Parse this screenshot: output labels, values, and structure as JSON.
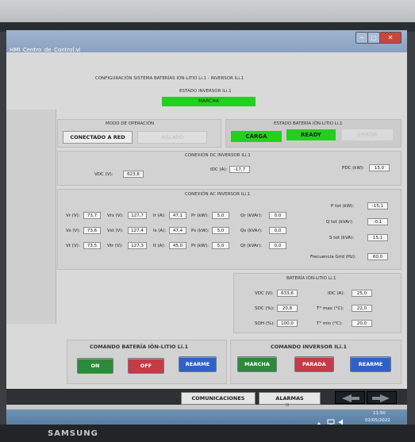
{
  "window": {
    "title": "HMI_Centro_de_Control.vi",
    "min_label": "−",
    "max_label": "□",
    "close_label": "✕"
  },
  "header": {
    "config_title": "CONFIGURACIÓN SISTEMA BATERÍAS IÓN-LITIO Li.1 - INVERSOR ILi.1",
    "inverter_state_title": "ESTADO INVERSOR ILi.1",
    "inverter_state_value": "MARCHA"
  },
  "operation_mode": {
    "title": "MODO DE OPERACIÓN",
    "connected": "CONECTADO A RED",
    "isolated": "AISLADO"
  },
  "battery_state": {
    "title": "ESTADO BATERÍA IÓN-LITIO Li.1",
    "charge": "CARGA",
    "ready": "READY",
    "error": "ERROR"
  },
  "dc": {
    "title": "CONEXIÓN DC INVERSOR ILi.1",
    "vdc_label": "VDC (V):",
    "vdc": "623,6",
    "idc_label": "IDC (A):",
    "idc": "-17,7",
    "pdc_label": "PDC (kW):",
    "pdc": "15,0"
  },
  "ac": {
    "title": "CONEXIÓN AC INVERSOR ILi.1",
    "rows": [
      {
        "v_label": "Vr (V):",
        "v": "73,7",
        "vv_label": "Vrs (V):",
        "vv": "127,7",
        "i_label": "Ir (A):",
        "i": "47,1",
        "p_label": "Pr (kW):",
        "p": "5,0",
        "q_label": "Qr (kVAr):",
        "q": "0,0"
      },
      {
        "v_label": "Vs (V):",
        "v": "73,6",
        "vv_label": "Vst (V):",
        "vv": "127,4",
        "i_label": "Is (A):",
        "i": "47,4",
        "p_label": "Ps (kW):",
        "p": "5,0",
        "q_label": "Qs (kVAr):",
        "q": "0,0"
      },
      {
        "v_label": "Vt (V):",
        "v": "73,5",
        "vv_label": "Vtr (V):",
        "vv": "127,3",
        "i_label": "It (A):",
        "i": "45,0",
        "p_label": "Pt (kW):",
        "p": "5,0",
        "q_label": "Qt (kVAr):",
        "q": "0,0"
      }
    ],
    "ptot_label": "P tot (kW):",
    "ptot": "-15,1",
    "qtot_label": "Q tot (kVAr):",
    "qtot": "-0,1",
    "stot_label": "S tot (kVA):",
    "stot": "15,1",
    "freq_label": "Frecuencia Grid (Hz):",
    "freq": "60,0"
  },
  "battery": {
    "title": "BATERÍA IÓN-LITIO Li.1",
    "vdc_label": "VDC (V):",
    "vdc": "633,6",
    "idc_label": "IDC (A):",
    "idc": "25,0",
    "soc_label": "SOC (%):",
    "soc": "20,8",
    "tmax_label": "T° max (°C):",
    "tmax": "22,0",
    "soh_label": "SOH (%):",
    "soh": "100,0",
    "tmin_label": "T° min (°C):",
    "tmin": "20,0"
  },
  "battery_command": {
    "title": "COMANDO BATERÍA IÓN-LITIO Li.1",
    "on": "ON",
    "off": "OFF",
    "reset": "REARME"
  },
  "inverter_command": {
    "title": "COMANDO INVERSOR ILi.1",
    "start": "MARCHA",
    "stop": "PARADA",
    "reset": "REARME"
  },
  "bottom_tabs": {
    "communications": "COMUNICACIONES",
    "alarms": "ALARMAS",
    "scroll_mark": "III"
  },
  "taskbar": {
    "time": "11:50",
    "date": "02/05/2022"
  },
  "bezel": {
    "brand": "SAMSUNG"
  },
  "colors": {
    "indicator_green": "#22d11d",
    "button_green": "#2e8a3b",
    "button_red": "#c63a45",
    "button_blue": "#2f62c8"
  }
}
